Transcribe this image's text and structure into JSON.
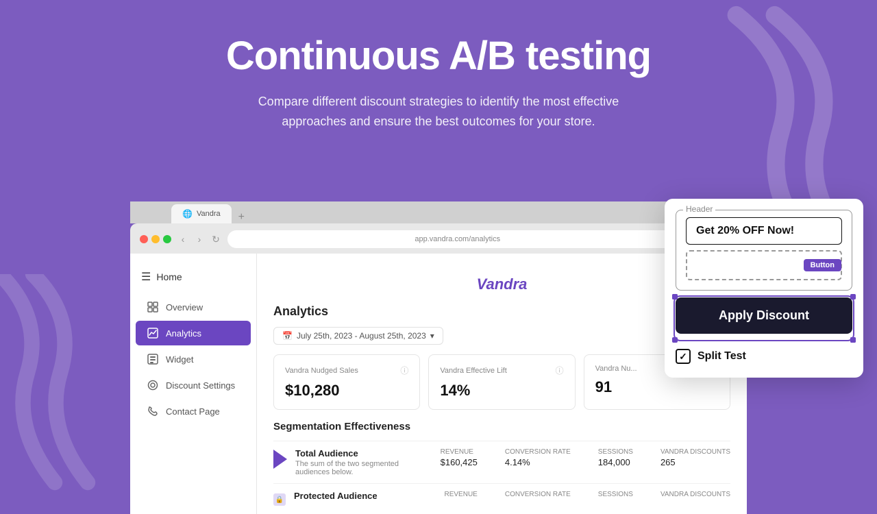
{
  "hero": {
    "title": "Continuous A/B testing",
    "subtitle": "Compare different discount strategies to identify the most effective approaches and ensure the best outcomes for your store."
  },
  "browser": {
    "tab_label": "",
    "add_tab": "+",
    "nav_back": "‹",
    "nav_forward": "›",
    "nav_reload": "↺"
  },
  "app": {
    "brand": "Vandra",
    "sidebar": {
      "home_label": "Home",
      "items": [
        {
          "label": "Overview",
          "icon": "grid-icon",
          "active": false
        },
        {
          "label": "Analytics",
          "icon": "chart-icon",
          "active": true
        },
        {
          "label": "Widget",
          "icon": "widget-icon",
          "active": false
        },
        {
          "label": "Discount Settings",
          "icon": "settings-icon",
          "active": false
        },
        {
          "label": "Contact Page",
          "icon": "phone-icon",
          "active": false
        }
      ]
    },
    "analytics": {
      "title": "Analytics",
      "date_range": "July 25th, 2023 - August 25th, 2023",
      "metrics": [
        {
          "label": "Vandra Nudged Sales",
          "value": "$10,280"
        },
        {
          "label": "Vandra Effective Lift",
          "value": "14%"
        },
        {
          "label": "Vandra Nu...",
          "value": "91"
        }
      ],
      "segmentation_title": "Segmentation Effectiveness",
      "segments": [
        {
          "name": "Total Audience",
          "desc": "The sum of the two segmented audiences below.",
          "revenue": "$160,425",
          "conversion_rate": "4.14%",
          "sessions": "184,000",
          "vandra_discounts": "265",
          "has_lock": false
        },
        {
          "name": "Protected Audience",
          "desc": "",
          "revenue": "",
          "conversion_rate": "",
          "sessions": "",
          "vandra_discounts": "",
          "has_lock": true
        }
      ]
    }
  },
  "popup": {
    "fieldset_legend": "Header",
    "header_input_value": "Get 20% OFF Now!",
    "button_badge": "Button",
    "apply_discount_label": "Apply Discount",
    "split_test_label": "Split Test",
    "split_test_checked": true
  },
  "labels": {
    "revenue": "REVENUE",
    "conversion_rate": "CONVERSION RATE",
    "sessions": "SESSIONS",
    "vandra_discounts": "VANDRA DISCOUNTS"
  }
}
